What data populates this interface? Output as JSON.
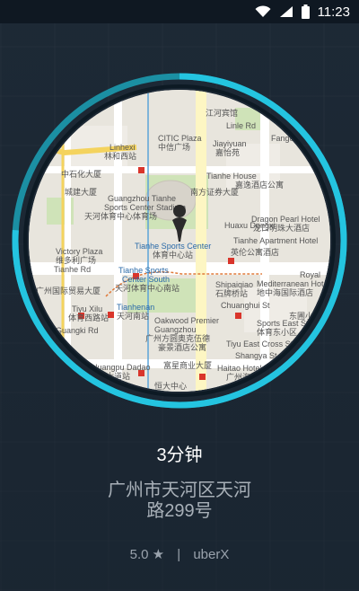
{
  "status_bar": {
    "time": "11:23"
  },
  "ride": {
    "eta": "3分钟",
    "address_line1": "广州市天河区天河",
    "address_line2": "路299号",
    "rating": "5.0",
    "rating_icon": "star-icon",
    "separator": "|",
    "product": "uberX",
    "progress": 0.76
  },
  "map": {
    "labels": [
      "江河宾馆",
      "Linle Rd",
      "Linhexi",
      "林和西站",
      "CITIC Plaza",
      "中信广场",
      "Jiayiyuan",
      "嘉怡苑",
      "Fangcun",
      "中石化大厦",
      "Tiyu W Rd",
      "Tianhe House",
      "嘉逸酒店公寓",
      "城建大厦",
      "Guangzhou Tianhe",
      "Sports Center Stadium",
      "天河体育中心体育场",
      "南方证券大厦",
      "Tiyu E Rd",
      "Huaxu Dongxi",
      "Dragon Pearl Hotel",
      "龙口明珠大酒店",
      "Tianhe Apartment Hotel",
      "Victory Plaza",
      "维多利广场",
      "Tianhe Sports Center",
      "体育中心站",
      "英伦公寓酒店",
      "Tianhe Rd",
      "Tianhe Sports",
      "Center South",
      "天河体育中心南站",
      "Shipaiqiao",
      "石牌桥站",
      "Mediterranean Hotel",
      "地中海国际酒店",
      "Royal",
      "广州国际贸易大厦",
      "Tiyu Xilu",
      "体育西路站",
      "Tianhenan",
      "天河南站",
      "Chuanghui St",
      "东圃小区",
      "Oakwood Premier",
      "Guangzhou",
      "广州方圆奥克伍德",
      "豪景酒店公寓",
      "Sports East St",
      "体育东小区",
      "Guangki Rd",
      "Tiyu East Cross St",
      "Huaxu Rd",
      "Huangpu Dadao",
      "黄埔大道站",
      "富星商业大厦",
      "Haitao Hotel Guangzhou",
      "广州海涛酒店",
      "Shangya St",
      "恒大中心"
    ]
  }
}
